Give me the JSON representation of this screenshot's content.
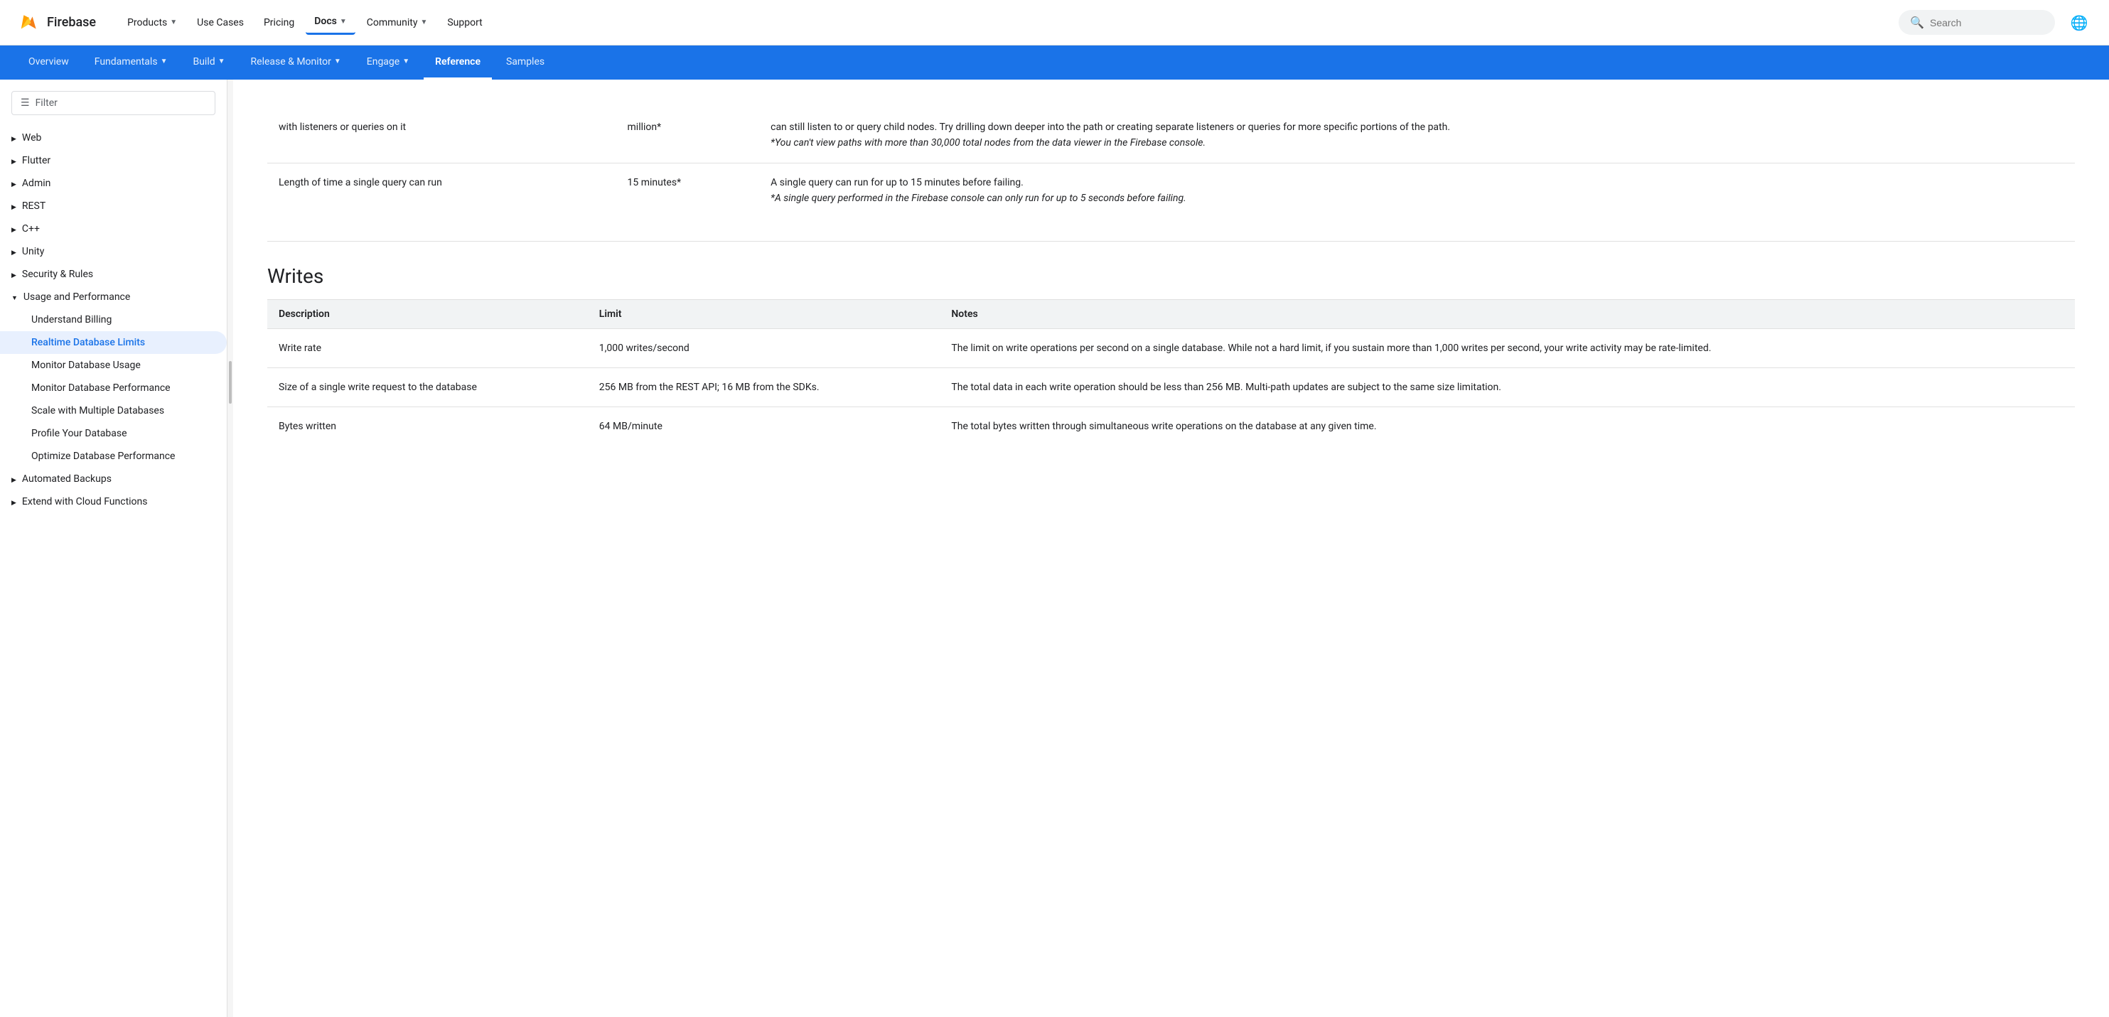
{
  "topNav": {
    "logoText": "Firebase",
    "links": [
      {
        "label": "Products",
        "hasChevron": true
      },
      {
        "label": "Use Cases",
        "hasChevron": false
      },
      {
        "label": "Pricing",
        "hasChevron": false
      },
      {
        "label": "Docs",
        "hasChevron": true,
        "active": true
      },
      {
        "label": "Community",
        "hasChevron": true
      },
      {
        "label": "Support",
        "hasChevron": false
      }
    ],
    "searchPlaceholder": "Search"
  },
  "secondaryNav": {
    "items": [
      {
        "label": "Overview"
      },
      {
        "label": "Fundamentals",
        "hasChevron": true
      },
      {
        "label": "Build",
        "hasChevron": true
      },
      {
        "label": "Release & Monitor",
        "hasChevron": true
      },
      {
        "label": "Engage",
        "hasChevron": true
      },
      {
        "label": "Reference",
        "active": true
      },
      {
        "label": "Samples"
      }
    ]
  },
  "sidebar": {
    "filterPlaceholder": "Filter",
    "items": [
      {
        "label": "Web",
        "type": "collapsed"
      },
      {
        "label": "Flutter",
        "type": "collapsed"
      },
      {
        "label": "Admin",
        "type": "collapsed"
      },
      {
        "label": "REST",
        "type": "collapsed"
      },
      {
        "label": "C++",
        "type": "collapsed"
      },
      {
        "label": "Unity",
        "type": "collapsed"
      },
      {
        "label": "Security & Rules",
        "type": "collapsed"
      },
      {
        "label": "Usage and Performance",
        "type": "expanded",
        "children": [
          {
            "label": "Understand Billing"
          },
          {
            "label": "Realtime Database Limits",
            "active": true
          },
          {
            "label": "Monitor Database Usage"
          },
          {
            "label": "Monitor Database Performance"
          },
          {
            "label": "Scale with Multiple Databases"
          },
          {
            "label": "Profile Your Database"
          },
          {
            "label": "Optimize Database Performance"
          }
        ]
      },
      {
        "label": "Automated Backups",
        "type": "collapsed"
      },
      {
        "label": "Extend with Cloud Functions",
        "type": "collapsed"
      }
    ]
  },
  "content": {
    "prevRows": [
      {
        "description": "with listeners or queries on it",
        "limit": "million*",
        "notes": "can still listen to or query child nodes. Try drilling down deeper into the path or creating separate listeners or queries for more specific portions of the path.\n*You can't view paths with more than 30,000 total nodes from the data viewer in the Firebase console."
      },
      {
        "description": "Length of time a single query can run",
        "limit": "15 minutes*",
        "notes": "A single query can run for up to 15 minutes before failing.\n*A single query performed in the Firebase console can only run for up to 5 seconds before failing."
      }
    ],
    "writesSection": {
      "title": "Writes",
      "tableHeaders": [
        "Description",
        "Limit",
        "Notes"
      ],
      "tableRows": [
        {
          "description": "Write rate",
          "limit": "1,000 writes/second",
          "notes": "The limit on write operations per second on a single database. While not a hard limit, if you sustain more than 1,000 writes per second, your write activity may be rate-limited."
        },
        {
          "description": "Size of a single write request to the database",
          "limit": "256 MB from the REST API; 16 MB from the SDKs.",
          "notes": "The total data in each write operation should be less than 256 MB. Multi-path updates are subject to the same size limitation."
        },
        {
          "description": "Bytes written",
          "limit": "64 MB/minute",
          "notes": "The total bytes written through simultaneous write operations on the database at any given time."
        }
      ]
    }
  }
}
